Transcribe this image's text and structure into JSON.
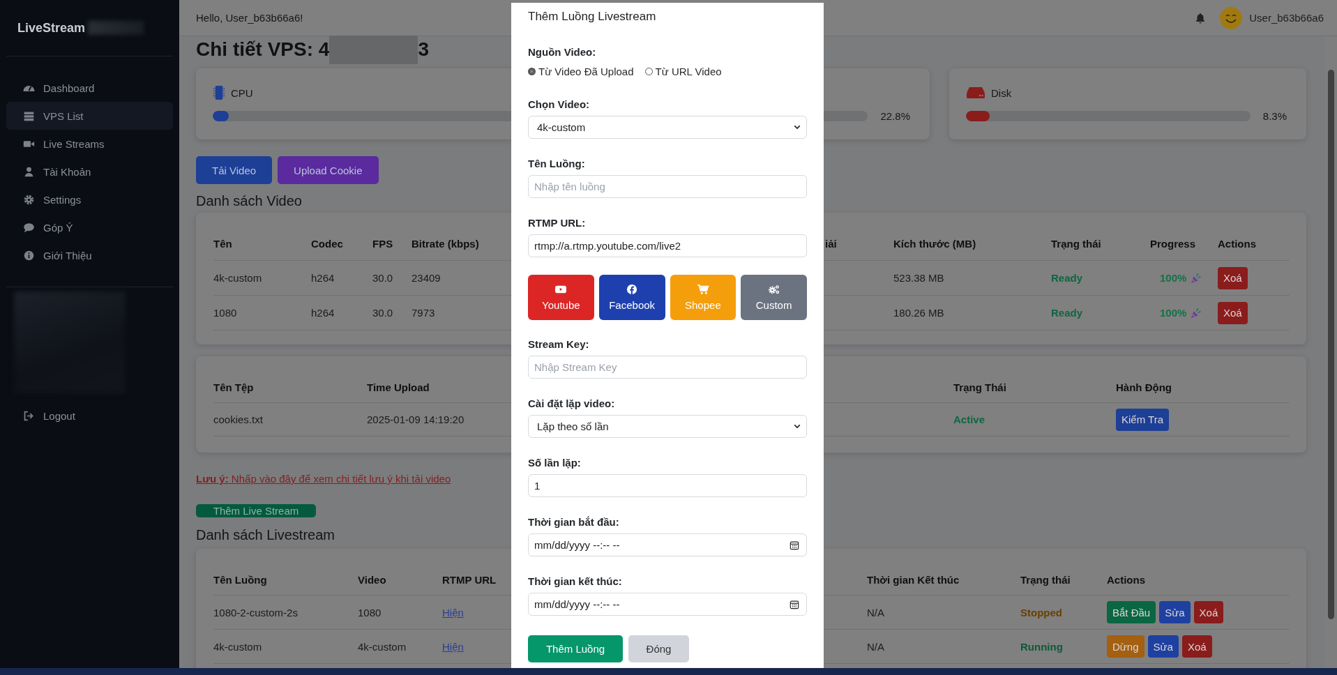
{
  "sidebar": {
    "logo": "LiveStream",
    "items": [
      {
        "label": "Dashboard",
        "kind": "gauge",
        "selected": false
      },
      {
        "label": "VPS List",
        "kind": "server",
        "selected": true
      },
      {
        "label": "Live Streams",
        "kind": "video",
        "selected": false
      },
      {
        "label": "Tài Khoản",
        "kind": "user",
        "selected": false
      },
      {
        "label": "Settings",
        "kind": "gear",
        "selected": false
      },
      {
        "label": "Góp Ý",
        "kind": "comment",
        "selected": false
      },
      {
        "label": "Giới Thiệu",
        "kind": "info",
        "selected": false
      }
    ],
    "logout": "Logout"
  },
  "header": {
    "greeting": "Hello, User_b63b66a6!",
    "username": "User_b63b66a6"
  },
  "page_title": {
    "text": "Chi tiết VPS: 4",
    "tail": "3"
  },
  "stats": [
    {
      "kind": "cpu",
      "label": "CPU",
      "level": 0.05
    },
    {
      "reading": "22.8%"
    },
    {
      "kind": "disk",
      "label": "Disk",
      "level": 0.083,
      "reading": "8.3%"
    }
  ],
  "buttons": [
    {
      "label": "Tải Video",
      "kind": "blue"
    },
    {
      "label": "Upload Cookie",
      "kind": "purple"
    }
  ],
  "videos": {
    "title": "Danh sách Video",
    "columns": [
      "Tên",
      "Codec",
      "FPS",
      "Bitrate (kbps)",
      "iải",
      "Kích thước (MB)",
      "Trạng thái",
      "Progress",
      "Actions"
    ],
    "rows": [
      {
        "name": "4k-custom",
        "codec": "h264",
        "fps": "30.0",
        "bitrate": "23409",
        "size": "523.38 MB",
        "status": {
          "label": "Ready",
          "kind": "ready"
        },
        "progress": "100%",
        "action": {
          "label": "Xoá",
          "kind": "delete"
        }
      },
      {
        "name": "1080",
        "codec": "h264",
        "fps": "30.0",
        "bitrate": "7973",
        "size": "180.26 MB",
        "status": {
          "label": "Ready",
          "kind": "ready"
        },
        "progress": "100%",
        "action": {
          "label": "Xoá",
          "kind": "delete"
        }
      }
    ]
  },
  "cookies": {
    "columns": [
      "Tên Tệp",
      "Time Upload",
      "Trạng Thái",
      "Hành Động"
    ],
    "rows": [
      {
        "file": "cookies.txt",
        "time": "2025-01-09 14:19:20",
        "status": {
          "label": "Active",
          "kind": "active"
        },
        "action": {
          "label": "Kiểm Tra",
          "kind": "check"
        }
      }
    ]
  },
  "note": "**Lưu ý:** Nhấp vào đây để xem chi tiết lưu ý khi tải video",
  "add_button": "Thêm Live Stream",
  "livestreams": {
    "title": "Danh sách Livestream",
    "columns": [
      "Tên Luồng",
      "Video",
      "RTMP URL",
      "Thời gian Kết thúc",
      "Trạng thái",
      "Actions"
    ],
    "rows": [
      {
        "name": "1080-2-custom-2s",
        "video": "1080",
        "rtmp": "Hiện",
        "end": "N/A",
        "status": {
          "label": "Stopped",
          "kind": "stopped"
        },
        "actions": [
          {
            "label": "Bắt Đầu",
            "kind": "start"
          },
          {
            "label": "Sửa",
            "kind": "edit"
          },
          {
            "label": "Xoá",
            "kind": "delete"
          }
        ]
      },
      {
        "name": "4k-custom",
        "video": "4k-custom",
        "rtmp": "Hiện",
        "end": "N/A",
        "status": {
          "label": "Running",
          "kind": "running"
        },
        "actions": [
          {
            "label": "Dừng",
            "kind": "stop"
          },
          {
            "label": "Sửa",
            "kind": "edit"
          },
          {
            "label": "Xoá",
            "kind": "delete"
          }
        ]
      }
    ]
  },
  "modal": {
    "title": "Thêm Luồng Livestream",
    "source": {
      "label": "Nguồn Video:",
      "options": [
        {
          "label": "Từ Video Đã Upload",
          "selected": true
        },
        {
          "label": "Từ URL Video",
          "selected": false
        }
      ]
    },
    "fields": [
      {
        "kind": "select",
        "label": "Chọn Video:",
        "value": "4k-custom"
      },
      {
        "kind": "text",
        "label": "Tên Luồng:",
        "placeholder": "Nhập tên luồng"
      },
      {
        "kind": "text",
        "label": "RTMP URL:",
        "value": "rtmp://a.rtmp.youtube.com/live2"
      },
      {
        "kind": "platforms",
        "items": [
          {
            "label": "Youtube",
            "kind": "youtube"
          },
          {
            "label": "Facebook",
            "kind": "facebook"
          },
          {
            "label": "Shopee",
            "kind": "shopee"
          },
          {
            "label": "Custom",
            "kind": "custom"
          }
        ]
      },
      {
        "kind": "text",
        "label": "Stream Key:",
        "placeholder": "Nhập Stream Key"
      },
      {
        "kind": "select",
        "label": "Cài đặt lặp video:",
        "value": "Lặp theo số lần"
      },
      {
        "kind": "text",
        "label": "Số lần lặp:",
        "value": "1"
      },
      {
        "kind": "datetime",
        "label": "Thời gian bắt đầu:",
        "value": "mm/dd/yyyy --:-- --"
      },
      {
        "kind": "datetime",
        "label": "Thời gian kết thúc:",
        "value": "mm/dd/yyyy --:-- --"
      }
    ],
    "buttons": [
      {
        "label": "Thêm Luồng",
        "kind": "submit"
      },
      {
        "label": "Đóng",
        "kind": "close"
      }
    ]
  }
}
